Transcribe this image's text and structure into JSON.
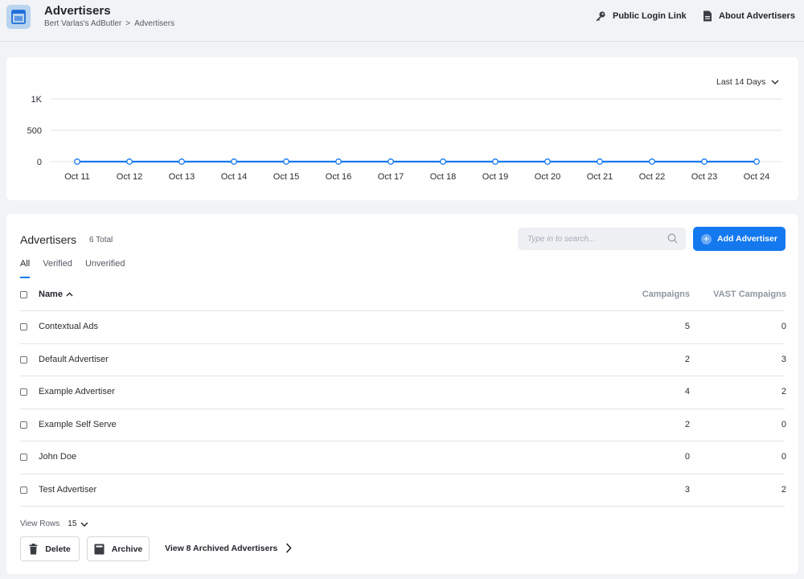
{
  "header": {
    "title": "Advertisers",
    "breadcrumb": [
      "Bert Varlas's AdButler",
      "Advertisers"
    ],
    "breadcrumb_sep": ">",
    "public_login_label": "Public Login Link",
    "about_label": "About Advertisers"
  },
  "chart_card": {
    "range_label": "Last 14 Days"
  },
  "chart_data": {
    "type": "line",
    "categories": [
      "Oct 11",
      "Oct 12",
      "Oct 13",
      "Oct 14",
      "Oct 15",
      "Oct 16",
      "Oct 17",
      "Oct 18",
      "Oct 19",
      "Oct 20",
      "Oct 21",
      "Oct 22",
      "Oct 23",
      "Oct 24"
    ],
    "series": [
      {
        "values": [
          0,
          0,
          0,
          0,
          0,
          0,
          0,
          0,
          0,
          0,
          0,
          0,
          0,
          0
        ],
        "color": "#1479ef"
      }
    ],
    "yticks": [
      0,
      500,
      1000
    ],
    "ytick_labels": [
      "0",
      "500",
      "1K"
    ],
    "ylim": [
      0,
      1000
    ],
    "grid": true
  },
  "table": {
    "title": "Advertisers",
    "total": "6 Total",
    "search_placeholder": "Type in to search...",
    "add_label": "Add Advertiser",
    "tabs": [
      "All",
      "Verified",
      "Unverified"
    ],
    "columns": {
      "name": "Name",
      "campaigns": "Campaigns",
      "vast": "VAST Campaigns"
    },
    "rows": [
      {
        "name": "Contextual Ads",
        "campaigns": "5",
        "vast": "0"
      },
      {
        "name": "Default Advertiser",
        "campaigns": "2",
        "vast": "3"
      },
      {
        "name": "Example Advertiser",
        "campaigns": "4",
        "vast": "2"
      },
      {
        "name": "Example Self Serve",
        "campaigns": "2",
        "vast": "0"
      },
      {
        "name": "John Doe",
        "campaigns": "0",
        "vast": "0"
      },
      {
        "name": "Test Advertiser",
        "campaigns": "3",
        "vast": "2"
      }
    ],
    "view_rows_label": "View Rows",
    "view_rows_value": "15",
    "delete_label": "Delete",
    "archive_label": "Archive",
    "archived_link": "View 8 Archived Advertisers"
  },
  "colors": {
    "accent": "#1479ef",
    "background": "#f2f3f6"
  }
}
